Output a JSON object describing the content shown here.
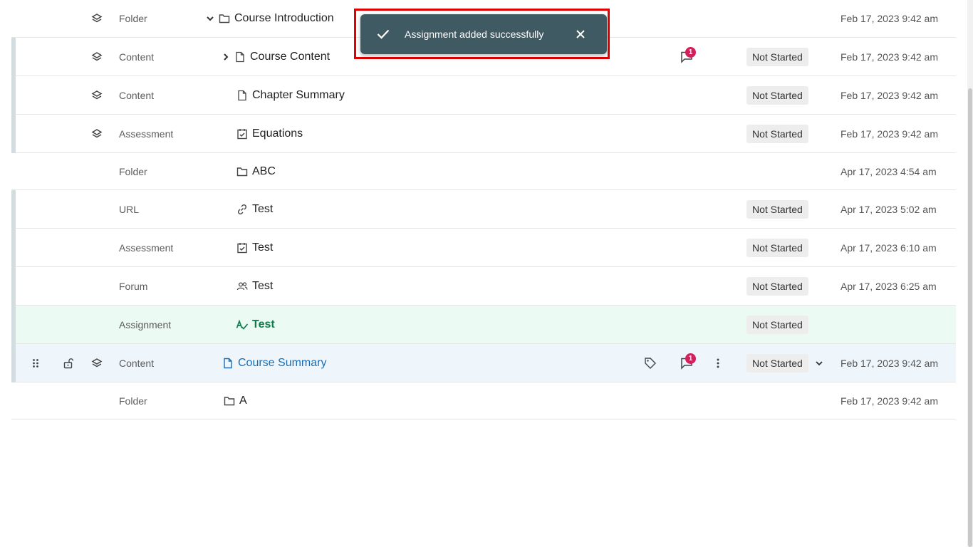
{
  "toast": {
    "message": "Assignment added successfully"
  },
  "rows": [
    {
      "type": "Folder",
      "name": "Course Introduction",
      "status": "",
      "date": "Feb 17, 2023 9:42 am"
    },
    {
      "type": "Content",
      "name": "Course Content",
      "status": "Not Started",
      "date": "Feb 17, 2023 9:42 am",
      "comment_count": "1"
    },
    {
      "type": "Content",
      "name": "Chapter Summary",
      "status": "Not Started",
      "date": "Feb 17, 2023 9:42 am"
    },
    {
      "type": "Assessment",
      "name": "Equations",
      "status": "Not Started",
      "date": "Feb 17, 2023 9:42 am"
    },
    {
      "type": "Folder",
      "name": "ABC",
      "status": "",
      "date": "Apr 17, 2023 4:54 am"
    },
    {
      "type": "URL",
      "name": "Test",
      "status": "Not Started",
      "date": "Apr 17, 2023 5:02 am"
    },
    {
      "type": "Assessment",
      "name": "Test",
      "status": "Not Started",
      "date": "Apr 17, 2023 6:10 am"
    },
    {
      "type": "Forum",
      "name": "Test",
      "status": "Not Started",
      "date": "Apr 17, 2023 6:25 am"
    },
    {
      "type": "Assignment",
      "name": "Test",
      "status": "Not Started",
      "date": ""
    },
    {
      "type": "Content",
      "name": "Course Summary",
      "status": "Not Started",
      "date": "Feb 17, 2023 9:42 am",
      "comment_count": "1"
    },
    {
      "type": "Folder",
      "name": "A",
      "status": "",
      "date": "Feb 17, 2023 9:42 am"
    }
  ],
  "colors": {
    "toast_bg": "#405a63",
    "highlight": "#e00000",
    "badge": "#d2215a",
    "link": "#1a6fb8",
    "new_item": "#0f7a4a"
  }
}
